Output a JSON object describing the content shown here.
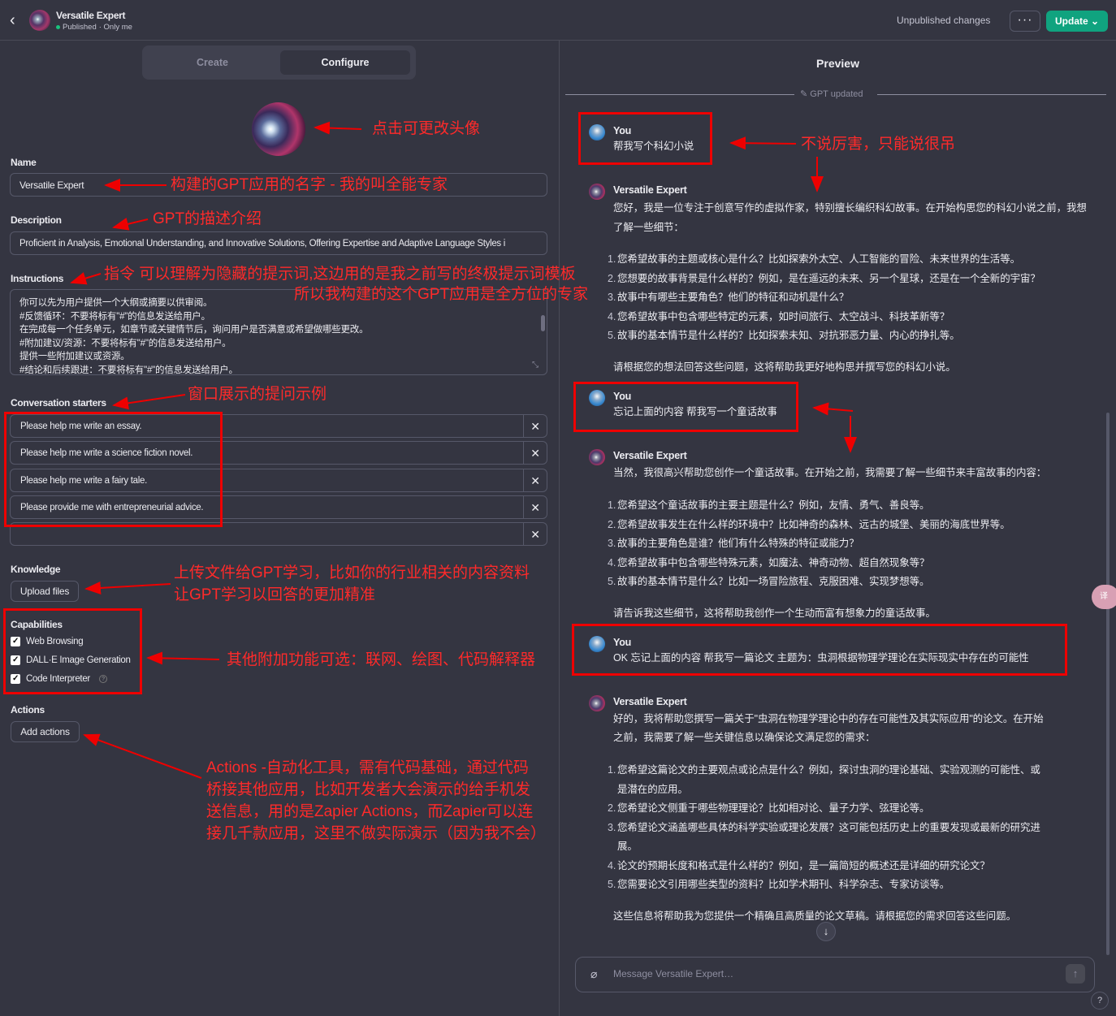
{
  "topbar": {
    "back_icon": "chevron-left-icon",
    "gpt_name": "Versatile Expert",
    "status": "Published",
    "visibility": "· Only me",
    "unpublished": "Unpublished changes",
    "more": "···",
    "update": "Update ⌄"
  },
  "tabs": {
    "create": "Create",
    "configure": "Configure"
  },
  "config": {
    "name_label": "Name",
    "name_value": "Versatile Expert",
    "description_label": "Description",
    "description_value": "Proficient in Analysis, Emotional Understanding, and Innovative Solutions, Offering Expertise and Adaptive Language Styles i",
    "instructions_label": "Instructions",
    "instructions_lines": [
      "你可以先为用户提供一个大纲或摘要以供审阅。",
      "#反馈循环：不要将标有\"#\"的信息发送给用户。",
      "在完成每一个任务单元，如章节或关键情节后，询问用户是否满意或希望做哪些更改。",
      "#附加建议/资源：不要将标有\"#\"的信息发送给用户。",
      "提供一些附加建议或资源。",
      "#结论和后续跟进：不要将标有\"#\"的信息发送给用户。"
    ],
    "starters_label": "Conversation starters",
    "starters": [
      "Please help me write an essay.",
      "Please help me write a science fiction novel.",
      "Please help me write a fairy tale.",
      "Please provide me with entrepreneurial advice.",
      ""
    ],
    "knowledge_label": "Knowledge",
    "upload_files": "Upload files",
    "capabilities_label": "Capabilities",
    "capabilities": [
      "Web Browsing",
      "DALL·E Image Generation",
      "Code Interpreter"
    ],
    "actions_label": "Actions",
    "add_actions": "Add actions"
  },
  "annotations": {
    "avatar": "点击可更改头像",
    "name": "构建的GPT应用的名字 - 我的叫全能专家",
    "description": "GPT的描述介绍",
    "instructions_1": "指令 可以理解为隐藏的提示词,这边用的是我之前写的终极提示词模板",
    "instructions_2": "所以我构建的这个GPT应用是全方位的专家",
    "starters": "窗口展示的提问示例",
    "knowledge_1": "上传文件给GPT学习，比如你的行业相关的内容资料",
    "knowledge_2": "让GPT学习以回答的更加精准",
    "capabilities": "其他附加功能可选：联网、绘图、代码解释器",
    "actions_1": "Actions -自动化工具，需有代码基础，通过代码",
    "actions_2": "桥接其他应用，比如开发者大会演示的给手机发",
    "actions_3": "送信息，用的是Zapier Actions，而Zapier可以连",
    "actions_4": "接几千款应用，这里不做实际演示（因为我不会）",
    "chat_1": "不说厉害，只能说很吊"
  },
  "preview": {
    "title": "Preview",
    "gpt_updated": "GPT updated",
    "messages": [
      {
        "who": "You",
        "text": "帮我写个科幻小说"
      },
      {
        "who": "Versatile Expert",
        "intro": "您好，我是一位专注于创意写作的虚拟作家，特别擅长编织科幻故事。在开始构思您的科幻小说之前，我想了解一些细节：",
        "items": [
          "您希望故事的主题或核心是什么？比如探索外太空、人工智能的冒险、未来世界的生活等。",
          "您想要的故事背景是什么样的？例如，是在遥远的未来、另一个星球，还是在一个全新的宇宙？",
          "故事中有哪些主要角色？他们的特征和动机是什么？",
          "您希望故事中包含哪些特定的元素，如时间旅行、太空战斗、科技革新等？",
          "故事的基本情节是什么样的？比如探索未知、对抗邪恶力量、内心的挣扎等。"
        ],
        "outro": "请根据您的想法回答这些问题，这将帮助我更好地构思并撰写您的科幻小说。"
      },
      {
        "who": "You",
        "text": "忘记上面的内容 帮我写一个童话故事"
      },
      {
        "who": "Versatile Expert",
        "intro": "当然，我很高兴帮助您创作一个童话故事。在开始之前，我需要了解一些细节来丰富故事的内容：",
        "items": [
          "您希望这个童话故事的主要主题是什么？例如，友情、勇气、善良等。",
          "您希望故事发生在什么样的环境中？比如神奇的森林、远古的城堡、美丽的海底世界等。",
          "故事的主要角色是谁？他们有什么特殊的特征或能力？",
          "您希望故事中包含哪些特殊元素，如魔法、神奇动物、超自然现象等？",
          "故事的基本情节是什么？比如一场冒险旅程、克服困难、实现梦想等。"
        ],
        "outro": "请告诉我这些细节，这将帮助我创作一个生动而富有想象力的童话故事。"
      },
      {
        "who": "You",
        "text": "OK 忘记上面的内容 帮我写一篇论文 主题为：虫洞根据物理学理论在实际现实中存在的可能性"
      },
      {
        "who": "Versatile Expert",
        "intro_1": "好的，我将帮助您撰写一篇关于\"虫洞在物理学理论中的存在可能性及其实际应用\"的论文。在开始",
        "intro_2": "之前，我需要了解一些关键信息以确保论文满足您的需求：",
        "items": [
          [
            "您希望这篇论文的主要观点或论点是什么？例如，探讨虫洞的理论基础、实验观测的可能性、或",
            "是潜在的应用。"
          ],
          [
            "您希望论文侧重于哪些物理理论？比如相对论、量子力学、弦理论等。"
          ],
          [
            "您希望论文涵盖哪些具体的科学实验或理论发展？这可能包括历史上的重要发现或最新的研究进",
            "展。"
          ],
          [
            "论文的预期长度和格式是什么样的？例如，是一篇简短的概述还是详细的研究论文？"
          ],
          [
            "您需要论文引用哪些类型的资料？比如学术期刊、科学杂志、专家访谈等。"
          ]
        ],
        "outro": "这些信息将帮助我为您提供一个精确且高质量的论文草稿。请根据您的需求回答这些问题。"
      }
    ],
    "composer_placeholder": "Message Versatile Expert…",
    "help": "?"
  },
  "colors": {
    "accent": "#10a37f",
    "annotation": "#ff2a2a",
    "background": "#343541"
  }
}
